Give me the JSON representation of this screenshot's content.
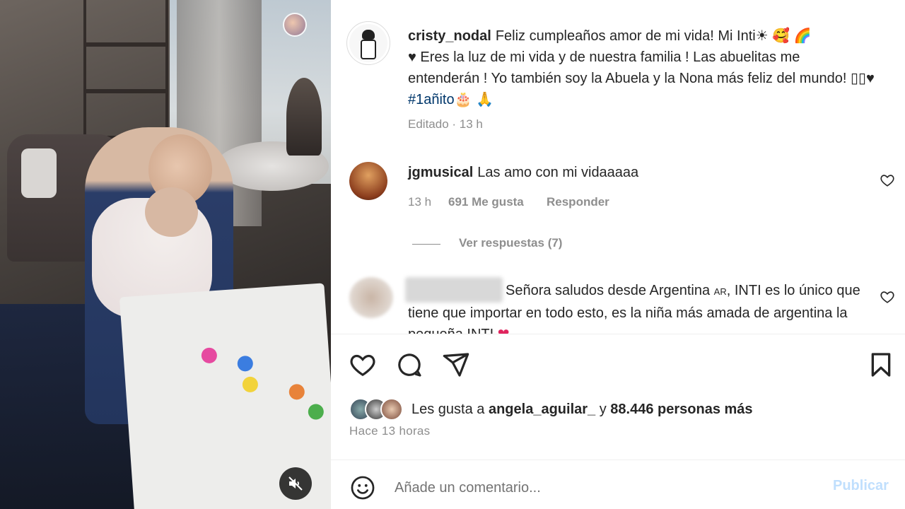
{
  "post": {
    "author": "cristy_nodal",
    "caption_part1": "Feliz cumpleaños amor de mi vida! Mi Inti",
    "caption_part2": "♥ Eres la luz de mi vida y de nuestra familia ! Las abuelitas me entenderán ! Yo también soy la Abuela y la Nona más feliz del mundo! ",
    "caption_symbols": "▯▯♥",
    "hashtag": "#1añito",
    "caption_emojis_1": "☀ 🥰 🌈",
    "caption_emojis_2": "🎂 🙏",
    "edited_label": "Editado",
    "time_label": "13 h"
  },
  "comments": [
    {
      "username": "jgmusical",
      "text": "Las amo con mi vidaaaaa",
      "time": "13 h",
      "likes": "691 Me gusta",
      "reply_label": "Responder",
      "view_replies": "Ver respuestas (7)"
    },
    {
      "text_part1": "Señora saludos desde Argentina ",
      "flag": "AR",
      "text_part2": ", INTI es lo único que tiene que importar en todo esto, es la niña más amada de argentina la pequeña INTI ",
      "heart": "❤"
    }
  ],
  "likes": {
    "prefix": "Les gusta a ",
    "user": "angela_aguilar_",
    "middle": " y ",
    "others": "88.446 personas más"
  },
  "post_time": "Hace 13 horas",
  "composer": {
    "placeholder": "Añade un comentario...",
    "publish_label": "Publicar"
  },
  "colors": {
    "hashtag": "#00376b",
    "publish_disabled": "#c0dffd",
    "secondary_text": "#8e8e8e"
  },
  "icons": [
    "heart-icon",
    "comment-icon",
    "share-icon",
    "bookmark-icon",
    "emoji-icon",
    "mute-icon"
  ]
}
